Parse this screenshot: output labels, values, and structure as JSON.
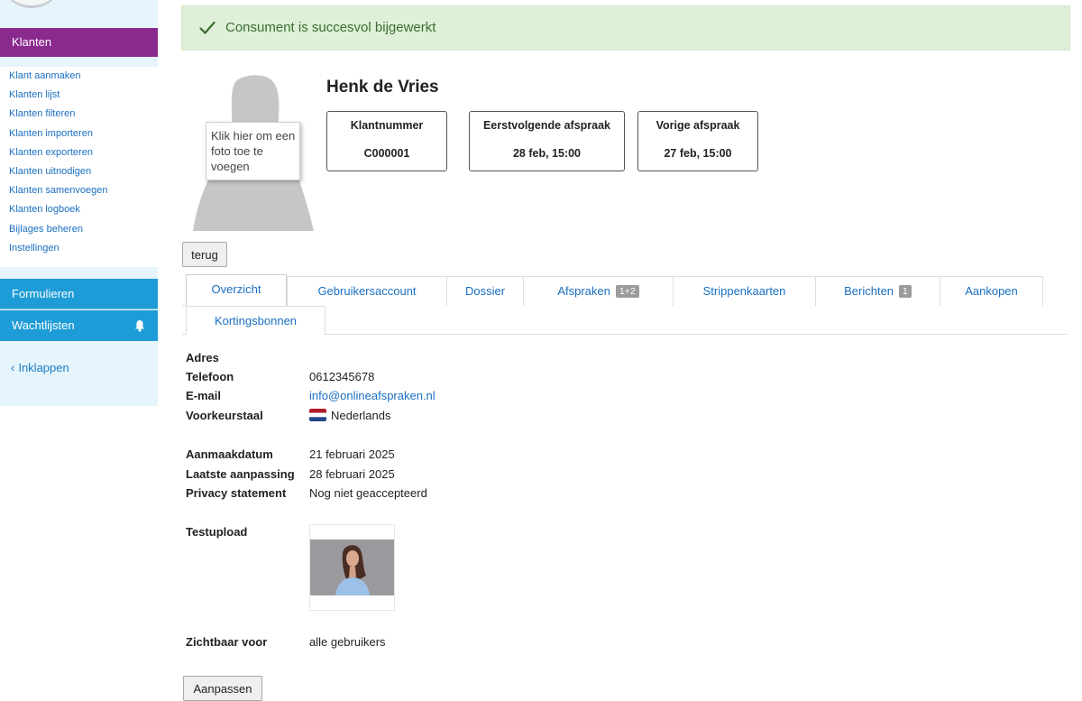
{
  "sidebar": {
    "main_item": "Klanten",
    "sub_items": [
      "Klant aanmaken",
      "Klanten lijst",
      "Klanten filteren",
      "Klanten importeren",
      "Klanten exporteren",
      "Klanten uitnodigen",
      "Klanten samenvoegen",
      "Klanten logboek",
      "Bijlages beheren",
      "Instellingen"
    ],
    "formulieren": "Formulieren",
    "wachtlijsten": "Wachtlijsten",
    "collapse": "Inklappen"
  },
  "alert": {
    "message": "Consument is succesvol bijgewerkt"
  },
  "profile": {
    "name": "Henk de Vries",
    "photo_tooltip": "Klik hier om een foto toe te voegen",
    "cards": [
      {
        "label": "Klantnummer",
        "value": "C000001"
      },
      {
        "label": "Eerstvolgende afspraak",
        "value": "28 feb, 15:00"
      },
      {
        "label": "Vorige afspraak",
        "value": "27 feb, 15:00"
      }
    ],
    "back_button": "terug"
  },
  "tabs": {
    "overzicht": "Overzicht",
    "gebruikersaccount": "Gebruikersaccount",
    "dossier": "Dossier",
    "afspraken": "Afspraken",
    "afspraken_badge": "1+2",
    "strippenkaarten": "Strippenkaarten",
    "berichten": "Berichten",
    "berichten_badge": "1",
    "aankopen": "Aankopen",
    "kortingsbonnen": "Kortingsbonnen",
    "active": "Overzicht"
  },
  "details": {
    "adres_label": "Adres",
    "telefoon_label": "Telefoon",
    "telefoon": "0612345678",
    "email_label": "E-mail",
    "email": "info@onlineafspraken.nl",
    "taal_label": "Voorkeurstaal",
    "taal": "Nederlands",
    "aanmaak_label": "Aanmaakdatum",
    "aanmaak": "21 februari 2025",
    "aanpassing_label": "Laatste aanpassing",
    "aanpassing": "28 februari 2025",
    "privacy_label": "Privacy statement",
    "privacy": "Nog niet geaccepteerd",
    "upload_label": "Testupload",
    "zichtbaar_label": "Zichtbaar voor",
    "zichtbaar": "alle gebruikers"
  },
  "edit_button": "Aanpassen",
  "colors": {
    "klanten_bg": "#8a2a8e",
    "nav_blue": "#1e9cd7",
    "sidebar_bg": "#e6f4fc",
    "alert_bg": "#dff0d8",
    "link": "#1a6fc2"
  }
}
